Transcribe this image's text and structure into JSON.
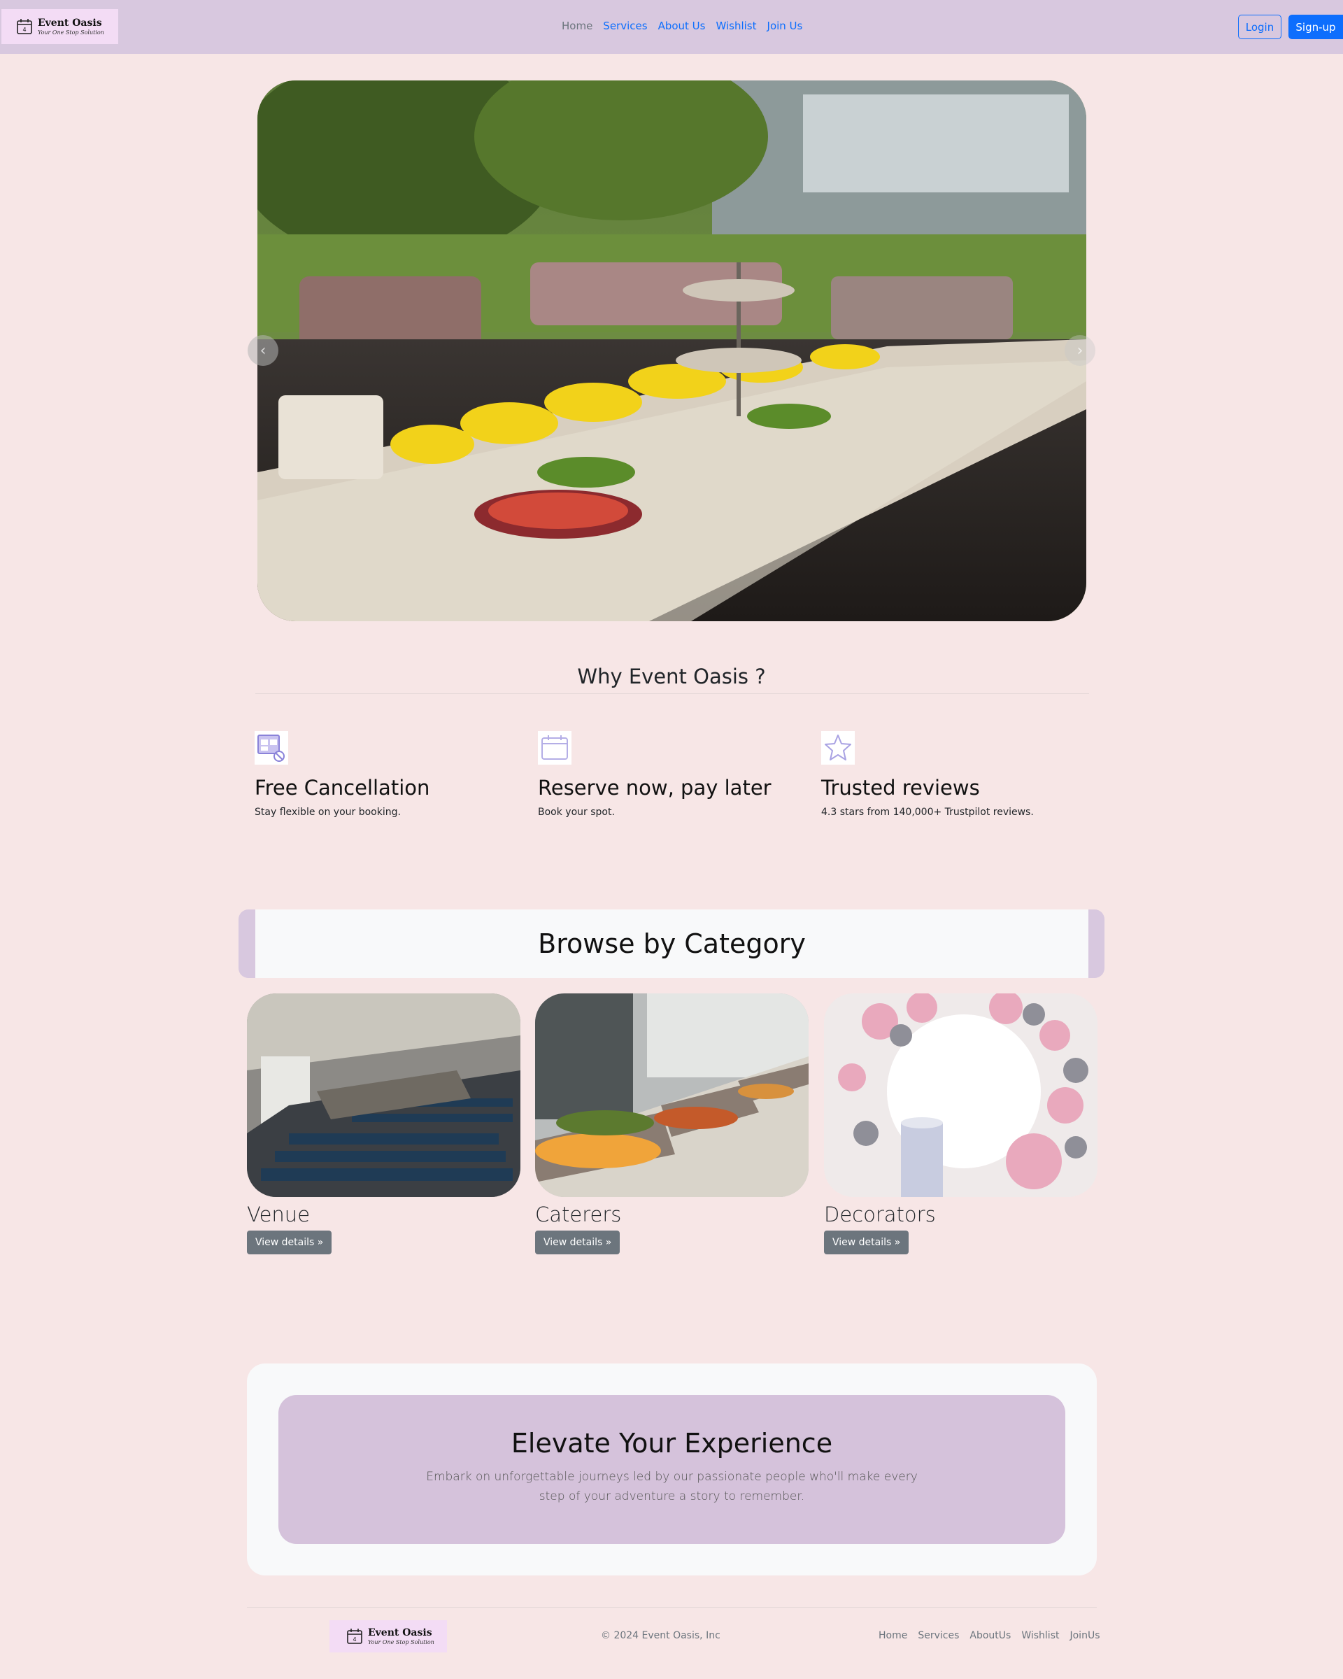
{
  "brand": {
    "name": "Event Oasis",
    "tagline": "Your One Stop Solution"
  },
  "nav": {
    "links": [
      "Home",
      "Services",
      "About Us",
      "Wishlist",
      "Join Us"
    ]
  },
  "auth": {
    "login": "Login",
    "signup": "Sign-up"
  },
  "carousel": {
    "prev_icon": "chevron-left-icon",
    "next_icon": "chevron-right-icon"
  },
  "why": {
    "title": "Why Event Oasis ?",
    "features": [
      {
        "icon": "calendar-cancel-icon",
        "title": "Free Cancellation",
        "text": "Stay flexible on your booking."
      },
      {
        "icon": "calendar-icon",
        "title": "Reserve now, pay later",
        "text": "Book your spot."
      },
      {
        "icon": "star-icon",
        "title": "Trusted reviews",
        "text": "4.3 stars from 140,000+ Trustpilot reviews."
      }
    ]
  },
  "category": {
    "title": "Browse by Category",
    "cards": [
      {
        "title": "Venue",
        "button": "View details »"
      },
      {
        "title": "Caterers",
        "button": "View details »"
      },
      {
        "title": "Decorators",
        "button": "View details »"
      }
    ]
  },
  "elevate": {
    "title": "Elevate Your Experience",
    "text": "Embark on unforgettable journeys led by our passionate people who'll make every step of your adventure a story to remember."
  },
  "footer": {
    "copyright": "© 2024 Event Oasis, Inc",
    "links": [
      "Home",
      "Services",
      "AboutUs",
      "Wishlist",
      "JoinUs"
    ]
  },
  "colors": {
    "navbar": "#d8c8df",
    "page": "#f7e6e6",
    "primary": "#0d6efd",
    "secondary": "#6c757d",
    "accent_panel": "#d5c2db"
  }
}
